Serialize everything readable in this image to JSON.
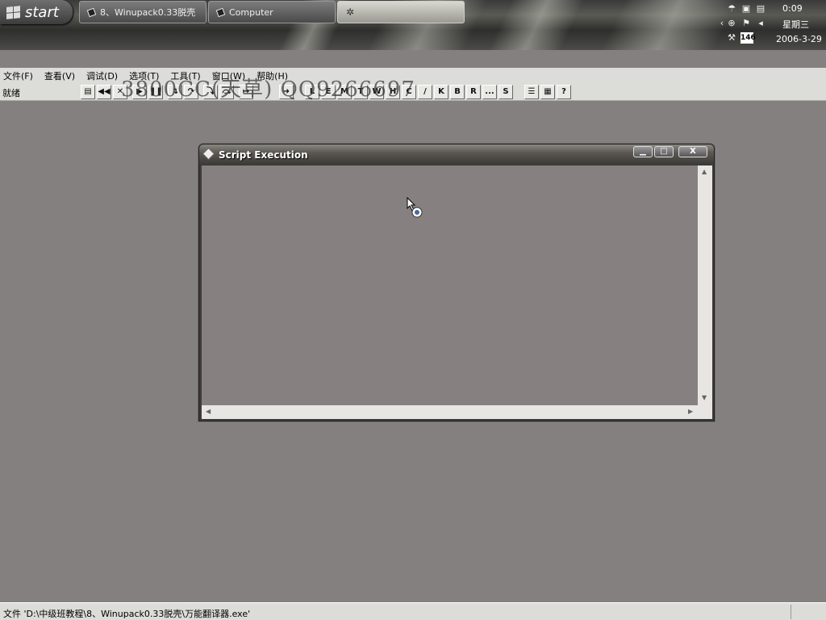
{
  "taskbar": {
    "start_label": "start",
    "tasks": [
      {
        "label": "8、Winupack0.33脱壳"
      },
      {
        "label": "Computer"
      },
      {
        "label": ""
      }
    ],
    "tray": {
      "time": "0:09",
      "day": "星期三",
      "date": "2006-3-29",
      "badge": "146"
    }
  },
  "menu": {
    "items": [
      {
        "label": "文件(F)"
      },
      {
        "label": "查看(V)"
      },
      {
        "label": "调试(D)"
      },
      {
        "label": "选项(T)"
      },
      {
        "label": "工具(T)"
      },
      {
        "label": "窗口(W)"
      },
      {
        "label": "帮助(H)"
      }
    ]
  },
  "toolbar": {
    "ready_label": "就绪",
    "watermark": "3800CC(天草) QQ9266697",
    "buttons": [
      "open",
      "rewind",
      "close",
      "run",
      "pause",
      "step-into",
      "step-over",
      "trace-into",
      "trace-over",
      "execute-till-return",
      "goto",
      "L",
      "E",
      "M",
      "T",
      "W",
      "H",
      "C",
      "/",
      "K",
      "B",
      "R",
      "...",
      "S",
      "list",
      "tile",
      "help"
    ],
    "letter_buttons": [
      "L",
      "E",
      "M",
      "T",
      "W",
      "H",
      "C",
      "/",
      "K",
      "B",
      "R",
      "...",
      "S"
    ]
  },
  "script_window": {
    "title": "Script Execution",
    "close_glyph": "X"
  },
  "statusbar": {
    "path": "文件 'D:\\中级班教程\\8、Winupack0.33脱壳\\万能翻译器.exe'"
  }
}
